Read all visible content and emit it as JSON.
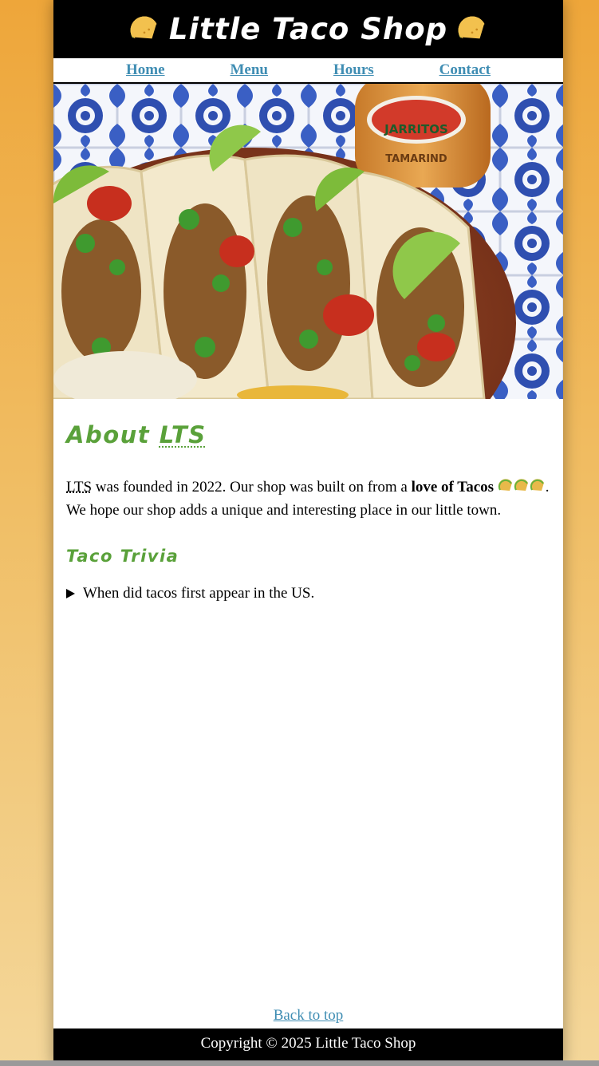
{
  "header": {
    "title": "Little Taco Shop",
    "left_icon": "taco-icon",
    "right_icon": "taco-icon"
  },
  "nav": {
    "items": [
      {
        "label": "Home"
      },
      {
        "label": "Menu"
      },
      {
        "label": "Hours"
      },
      {
        "label": "Contact"
      }
    ]
  },
  "hero": {
    "icon": "taco-photo",
    "bottle_label_top": "JARRITOS",
    "bottle_label_bottom": "TAMARIND"
  },
  "about": {
    "heading_prefix": "About",
    "heading_abbr": "LTS",
    "text_abbr": "LTS",
    "text_part1": "was founded in 2022. Our shop was built on from a",
    "text_bold": "love of Tacos",
    "text_part2": ". We hope our shop adds a unique and interesting place in our little town."
  },
  "trivia": {
    "heading": "Taco Trivia",
    "question": "When did tacos first appear in the US."
  },
  "back_to_top": "Back to top",
  "footer": {
    "copyright": "Copyright © 2025 Little Taco Shop"
  },
  "colors": {
    "accent_green": "#5aa13a",
    "link_blue": "#3f8db3",
    "background_orange": "#eea63a"
  }
}
